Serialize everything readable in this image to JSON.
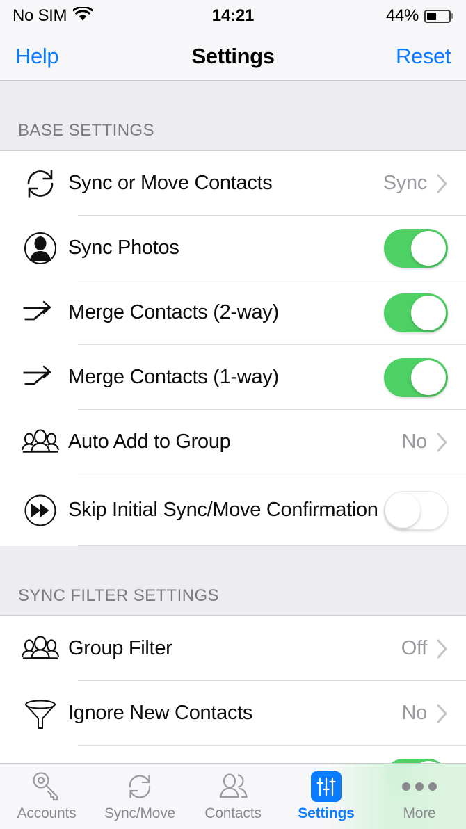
{
  "status_bar": {
    "carrier": "No SIM",
    "wifi_icon": "wifi-icon",
    "time": "14:21",
    "battery_percent": "44%",
    "battery_level": 44
  },
  "nav_bar": {
    "left_button": "Help",
    "title": "Settings",
    "right_button": "Reset"
  },
  "colors": {
    "accent_blue": "#0a7cff",
    "toggle_on_green": "#4ed164",
    "value_gray": "#9a9aa0",
    "section_bg": "#ececf1"
  },
  "sections": [
    {
      "header": "BASE SETTINGS",
      "rows": [
        {
          "icon": "sync-circular-arrows-icon",
          "label": "Sync or Move Contacts",
          "control": "disclosure",
          "value": "Sync"
        },
        {
          "icon": "person-in-circle-icon",
          "label": "Sync Photos",
          "control": "toggle",
          "value": "on"
        },
        {
          "icon": "merge-arrow-icon",
          "label": "Merge Contacts (2-way)",
          "control": "toggle",
          "value": "on"
        },
        {
          "icon": "merge-arrow-icon",
          "label": "Merge Contacts (1-way)",
          "control": "toggle",
          "value": "on"
        },
        {
          "icon": "group-people-icon",
          "label": "Auto Add to Group",
          "control": "disclosure",
          "value": "No"
        },
        {
          "icon": "fast-forward-circle-icon",
          "label": "Skip Initial Sync/Move Confirmation",
          "control": "toggle",
          "value": "off"
        }
      ]
    },
    {
      "header": "SYNC FILTER SETTINGS",
      "rows": [
        {
          "icon": "group-people-icon",
          "label": "Group Filter",
          "control": "disclosure",
          "value": "Off"
        },
        {
          "icon": "funnel-filter-icon",
          "label": "Ignore New Contacts",
          "control": "disclosure",
          "value": "No"
        },
        {
          "icon": "hidden-icon",
          "label": "",
          "control": "toggle",
          "value": "on"
        }
      ]
    }
  ],
  "tab_bar": {
    "tabs": [
      {
        "icon": "key-icon",
        "label": "Accounts",
        "active": false
      },
      {
        "icon": "sync-circular-arrows-icon",
        "label": "Sync/Move",
        "active": false
      },
      {
        "icon": "contacts-people-icon",
        "label": "Contacts",
        "active": false
      },
      {
        "icon": "sliders-icon",
        "label": "Settings",
        "active": true
      },
      {
        "icon": "ellipsis-icon",
        "label": "More",
        "active": false
      }
    ]
  }
}
